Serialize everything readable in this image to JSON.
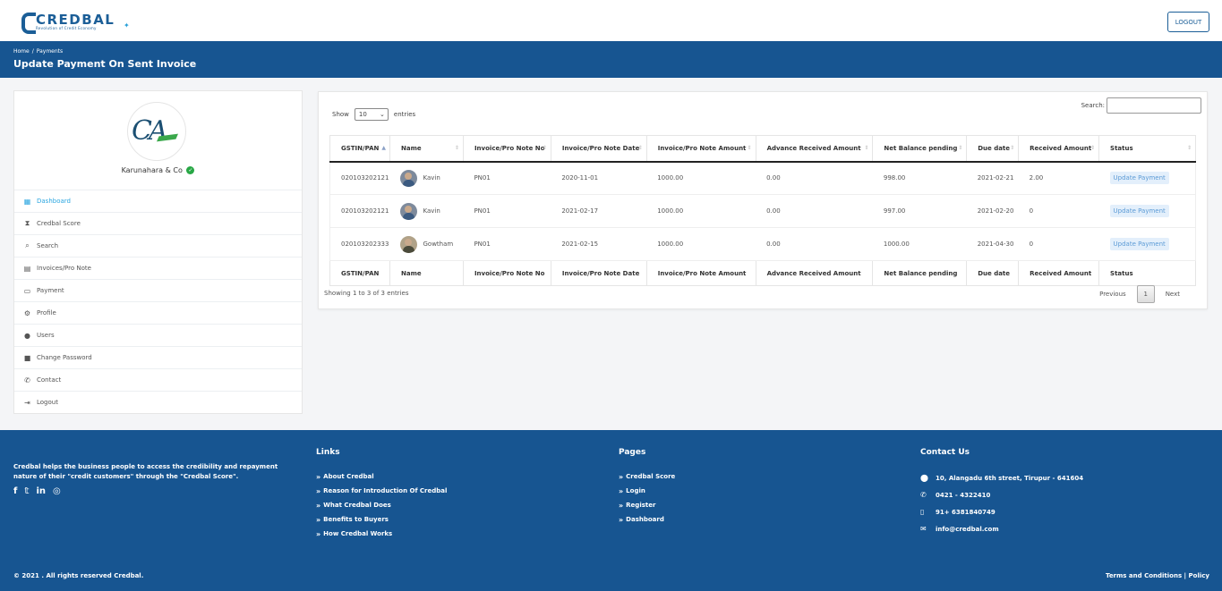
{
  "header": {
    "brand": "CREDBAL",
    "tagline": "Revolution of Credit Economy",
    "logout_label": "LOGOUT"
  },
  "band": {
    "breadcrumb": [
      "Home",
      "/",
      "Payments"
    ],
    "title": "Update Payment On Sent Invoice"
  },
  "profile": {
    "logo_text": "CA",
    "company_name": "Karunahara & Co"
  },
  "sidebar": {
    "items": [
      {
        "label": "Dashboard",
        "icon": "dashboard-icon",
        "active": true
      },
      {
        "label": "Credbal Score",
        "icon": "hourglass-icon",
        "active": false
      },
      {
        "label": "Search",
        "icon": "search-icon",
        "active": false
      },
      {
        "label": "Invoices/Pro Note",
        "icon": "file-icon",
        "active": false
      },
      {
        "label": "Payment",
        "icon": "credit-card-icon",
        "active": false
      },
      {
        "label": "Profile",
        "icon": "user-cog-icon",
        "active": false
      },
      {
        "label": "Users",
        "icon": "user-icon",
        "active": false
      },
      {
        "label": "Change Password",
        "icon": "lock-icon",
        "active": false
      },
      {
        "label": "Contact",
        "icon": "phone-icon",
        "active": false
      },
      {
        "label": "Logout",
        "icon": "sign-out-icon",
        "active": false
      }
    ]
  },
  "table": {
    "show_label": "Show",
    "entries_value": "10",
    "entries_label": "entries",
    "search_label": "Search:",
    "columns": [
      "GSTIN/PAN",
      "Name",
      "Invoice/Pro Note No",
      "Invoice/Pro Note Date",
      "Invoice/Pro Note Amount",
      "Advance Received Amount",
      "Net Balance pending",
      "Due date",
      "Received Amount",
      "Status"
    ],
    "rows": [
      {
        "gstin": "020103202121",
        "name": "Kavin",
        "invoice_no": "PN01",
        "date": "2020-11-01",
        "amount": "1000.00",
        "advance": "0.00",
        "net": "998.00",
        "due": "2021-02-21",
        "received": "2.00",
        "status": "Update Payment"
      },
      {
        "gstin": "020103202121",
        "name": "Kavin",
        "invoice_no": "PN01",
        "date": "2021-02-17",
        "amount": "1000.00",
        "advance": "0.00",
        "net": "997.00",
        "due": "2021-02-20",
        "received": "0",
        "status": "Update Payment"
      },
      {
        "gstin": "020103202333",
        "name": "Gowtham",
        "invoice_no": "PN01",
        "date": "2021-02-15",
        "amount": "1000.00",
        "advance": "0.00",
        "net": "1000.00",
        "due": "2021-04-30",
        "received": "0",
        "status": "Update Payment"
      }
    ],
    "info": "Showing 1 to 3 of 3 entries",
    "prev_label": "Previous",
    "current_page": "1",
    "next_label": "Next"
  },
  "footer": {
    "about": "Credbal helps the business people to access the credibility and repayment nature of their \"credit customers\" through the \"Credbal Score\".",
    "links_title": "Links",
    "links": [
      "About Credbal",
      "Reason for Introduction Of Credbal",
      "What Credbal Does",
      "Benefits to Buyers",
      "How Credbal Works"
    ],
    "pages_title": "Pages",
    "pages": [
      "Credbal Score",
      "Login",
      "Register",
      "Dashboard"
    ],
    "contact_title": "Contact Us",
    "contact": [
      {
        "icon": "map-marker-icon",
        "text": "10, Alangadu 6th street, Tirupur - 641604"
      },
      {
        "icon": "phone-icon",
        "text": "0421 - 4322410"
      },
      {
        "icon": "mobile-icon",
        "text": "91+ 6381840749"
      },
      {
        "icon": "envelope-icon",
        "text": "info@credbal.com"
      }
    ],
    "copyright": "© 2021 . All rights reserved Credbal.",
    "terms": "Terms and Conditions | Policy"
  }
}
